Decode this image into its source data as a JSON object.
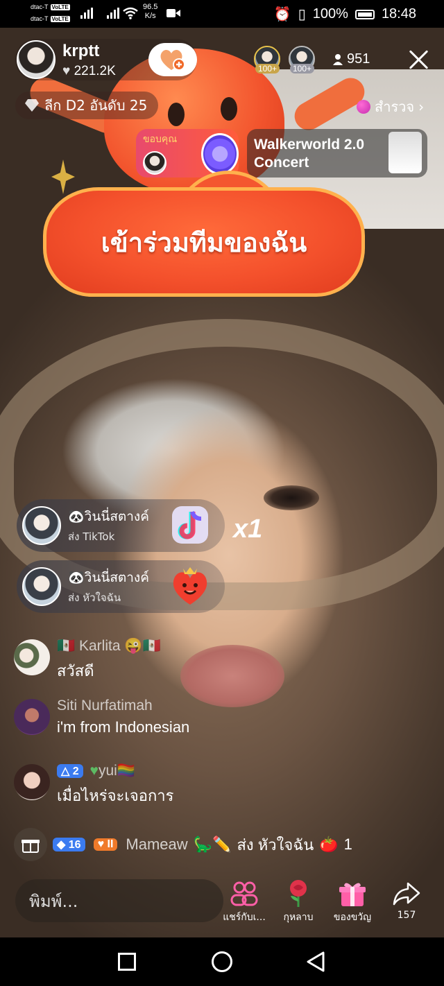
{
  "status_bar": {
    "carrier1": "dtac-T",
    "carrier2": "dtac-T",
    "volte_tag": "VoLTE",
    "net_speed_value": "96.5",
    "net_speed_unit": "K/s",
    "battery": "100%",
    "time": "18:48"
  },
  "host": {
    "name": "krptt",
    "likes": "221.2K"
  },
  "viewers": {
    "badge1": "100+",
    "badge2": "100+",
    "count": "951"
  },
  "rank": {
    "label": "ลีก D2 อันดับ 25"
  },
  "explore": {
    "label": "สำรวจ"
  },
  "thanks_card": {
    "label": "ขอบคุณ"
  },
  "concert_card": {
    "title_line1": "Walkerworld 2.0",
    "title_line2": "Concert"
  },
  "join_team": {
    "label": "เข้าร่วมทีมของฉัน"
  },
  "gift_combos": [
    {
      "name": "วินนี่สตางค์",
      "sub": "ส่ง TikTok",
      "icon": "tiktok-gift-icon"
    },
    {
      "name": "วินนี่สตางค์",
      "sub": "ส่ง หัวใจฉัน",
      "icon": "heart-character-gift-icon"
    }
  ],
  "combo_count": "x1",
  "chat": [
    {
      "name": "Karlita",
      "message": "สวัสดี"
    },
    {
      "name": "Siti Nurfatimah",
      "message": "i'm from Indonesian"
    },
    {
      "level": "2",
      "name": "yui",
      "message": "เมื่อไหร่จะเจอการ"
    }
  ],
  "system_message": {
    "level": "16",
    "fan_level": "II",
    "user": "Mameaw",
    "text": "ส่ง หัวใจฉัน",
    "count": "1"
  },
  "bottom_bar": {
    "input_placeholder": "พิมพ์...",
    "actions": [
      {
        "label": "แชร์กับเ...",
        "icon": "people-icon"
      },
      {
        "label": "กุหลาบ",
        "icon": "rose-icon"
      },
      {
        "label": "ของขวัญ",
        "icon": "gift-icon"
      },
      {
        "label": "157",
        "icon": "share-arrow-icon"
      }
    ]
  },
  "colors": {
    "accent_orange": "#f4512c",
    "level_blue": "#3b7bf0",
    "fan_orange": "#f07a2a",
    "rose_red": "#e0324a",
    "gift_pink": "#ff5fa8"
  }
}
